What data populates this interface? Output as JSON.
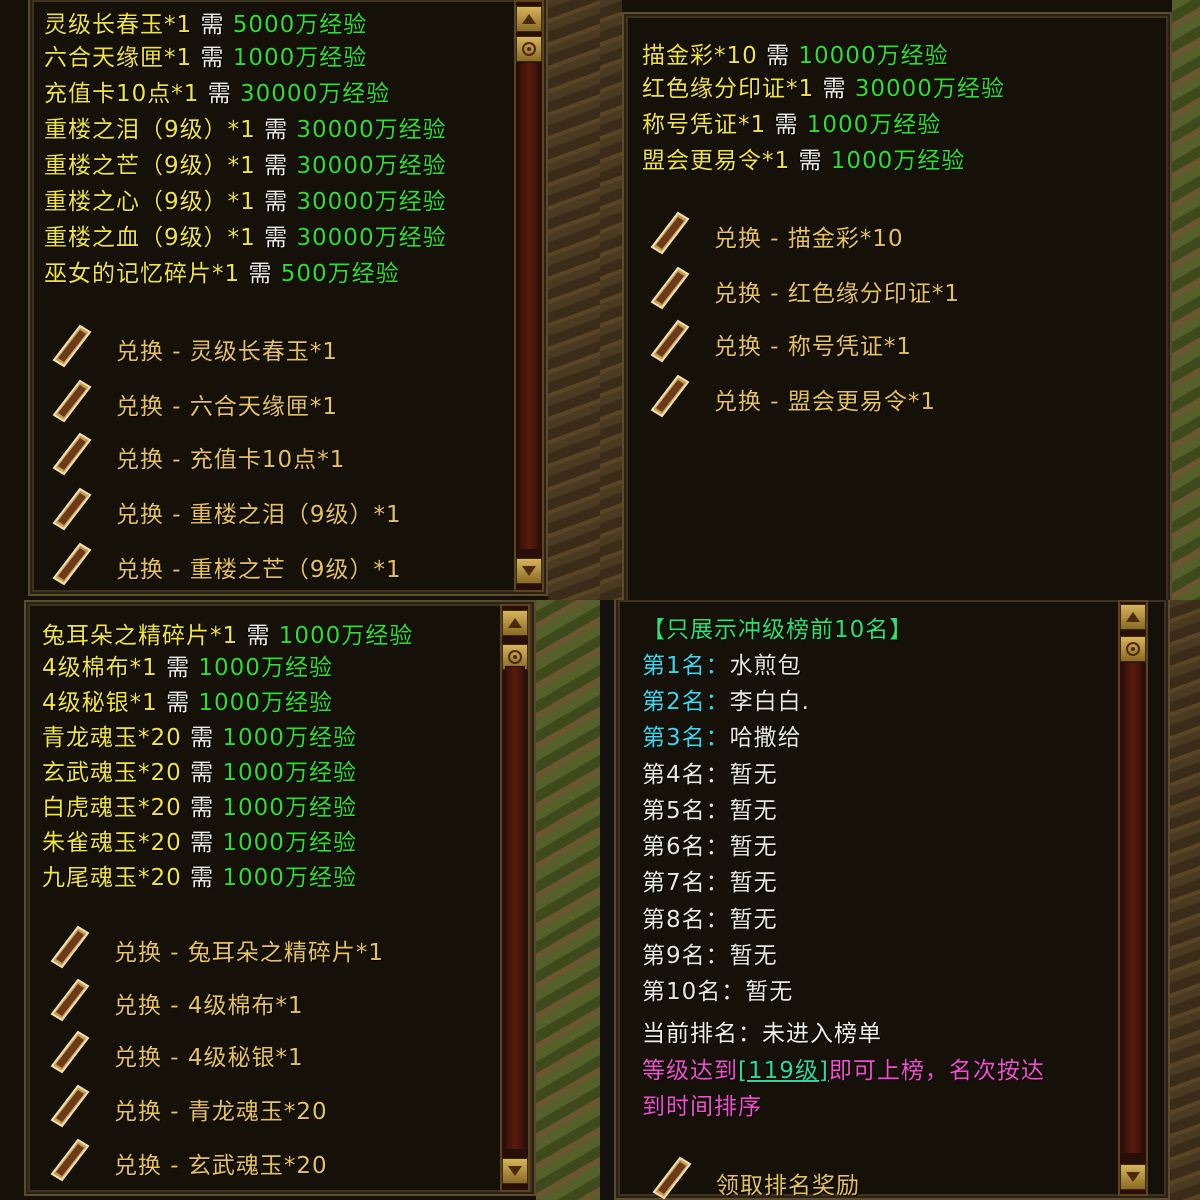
{
  "panels": {
    "top_left": {
      "requirements": [
        {
          "item": "灵级长春玉*1",
          "need": "需",
          "exp": "5000万经验"
        },
        {
          "item": "六合天缘匣*1",
          "need": "需",
          "exp": "1000万经验"
        },
        {
          "item": "充值卡10点*1",
          "need": "需",
          "exp": "30000万经验"
        },
        {
          "item": "重楼之泪（9级）*1",
          "need": "需",
          "exp": "30000万经验"
        },
        {
          "item": "重楼之芒（9级）*1",
          "need": "需",
          "exp": "30000万经验"
        },
        {
          "item": "重楼之心（9级）*1",
          "need": "需",
          "exp": "30000万经验"
        },
        {
          "item": "重楼之血（9级）*1",
          "need": "需",
          "exp": "30000万经验"
        },
        {
          "item": "巫女的记忆碎片*1",
          "need": "需",
          "exp": "500万经验"
        }
      ],
      "exchange_buttons": [
        "兑换 - 灵级长春玉*1",
        "兑换 - 六合天缘匣*1",
        "兑换 - 充值卡10点*1",
        "兑换 - 重楼之泪（9级）*1",
        "兑换 - 重楼之芒（9级）*1"
      ]
    },
    "top_right": {
      "requirements": [
        {
          "item": "描金彩*10",
          "need": "需",
          "exp": "10000万经验"
        },
        {
          "item": "红色缘分印证*1",
          "need": "需",
          "exp": "30000万经验"
        },
        {
          "item": "称号凭证*1",
          "need": "需",
          "exp": "1000万经验"
        },
        {
          "item": "盟会更易令*1",
          "need": "需",
          "exp": "1000万经验"
        }
      ],
      "exchange_buttons": [
        "兑换 - 描金彩*10",
        "兑换 - 红色缘分印证*1",
        "兑换 - 称号凭证*1",
        "兑换 - 盟会更易令*1"
      ]
    },
    "bottom_left": {
      "requirements": [
        {
          "item": "兔耳朵之精碎片*1",
          "need": "需",
          "exp": "1000万经验"
        },
        {
          "item": "4级棉布*1",
          "need": "需",
          "exp": "1000万经验"
        },
        {
          "item": "4级秘银*1",
          "need": "需",
          "exp": "1000万经验"
        },
        {
          "item": "青龙魂玉*20",
          "need": "需",
          "exp": "1000万经验"
        },
        {
          "item": "玄武魂玉*20",
          "need": "需",
          "exp": "1000万经验"
        },
        {
          "item": "白虎魂玉*20",
          "need": "需",
          "exp": "1000万经验"
        },
        {
          "item": "朱雀魂玉*20",
          "need": "需",
          "exp": "1000万经验"
        },
        {
          "item": "九尾魂玉*20",
          "need": "需",
          "exp": "1000万经验"
        }
      ],
      "exchange_buttons": [
        "兑换 - 兔耳朵之精碎片*1",
        "兑换 - 4级棉布*1",
        "兑换 - 4级秘银*1",
        "兑换 - 青龙魂玉*20",
        "兑换 - 玄武魂玉*20"
      ]
    },
    "bottom_right": {
      "header": "【只展示冲级榜前10名】",
      "ranking": [
        {
          "rank": "第1名",
          "sep": "：",
          "name": "水煎包"
        },
        {
          "rank": "第2名",
          "sep": "：",
          "name": "李白白."
        },
        {
          "rank": "第3名",
          "sep": "：",
          "name": "哈撒给"
        },
        {
          "rank": "第4名",
          "sep": "：",
          "name": "暂无"
        },
        {
          "rank": "第5名",
          "sep": "：",
          "name": "暂无"
        },
        {
          "rank": "第6名",
          "sep": "：",
          "name": "暂无"
        },
        {
          "rank": "第7名",
          "sep": "：",
          "name": "暂无"
        },
        {
          "rank": "第8名",
          "sep": "：",
          "name": "暂无"
        },
        {
          "rank": "第9名",
          "sep": "：",
          "name": "暂无"
        },
        {
          "rank": "第10名",
          "sep": "：",
          "name": "暂无"
        }
      ],
      "current_rank": "当前排名：未进入榜单",
      "rule_prefix": "等级达到",
      "rule_level": "[119级]",
      "rule_suffix": "即可上榜，名次按达",
      "rule_line2": "到时间排序",
      "claim_button": "领取排名奖励"
    }
  },
  "colors": {
    "item_yellow": "#f2e43a",
    "need_white": "#f0f0e8",
    "exp_green": "#2ee02a",
    "button_gold": "#e7c25a",
    "rank_cyan": "#38d8ee",
    "rule_pink": "#f14fcf"
  },
  "icons": {
    "exchange": "scroll-token-icon",
    "scroll_up": "scroll-up-arrow-icon",
    "scroll_target": "scroll-target-icon",
    "scroll_down": "scroll-down-arrow-icon"
  }
}
